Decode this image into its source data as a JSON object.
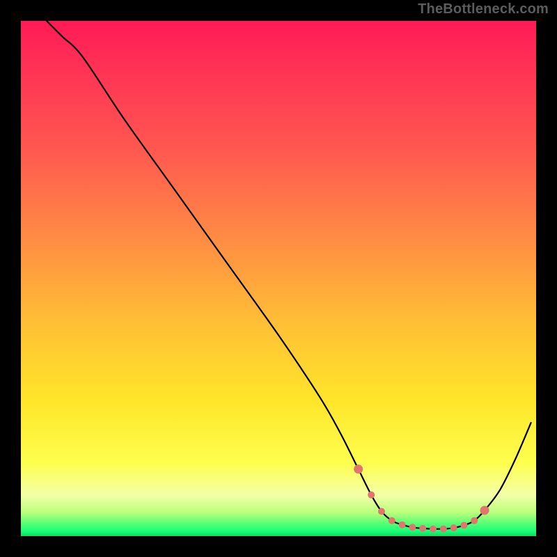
{
  "watermark": "TheBottleneck.com",
  "chart_data": {
    "type": "line",
    "title": "",
    "xlabel": "",
    "ylabel": "",
    "xlim": [
      0,
      100
    ],
    "ylim": [
      0,
      100
    ],
    "series": [
      {
        "name": "curve",
        "x": [
          5,
          8,
          12,
          20,
          30,
          40,
          50,
          58,
          62,
          65.5,
          68,
          70,
          72,
          74,
          76,
          78,
          80,
          82,
          84,
          86,
          88,
          90,
          93,
          96,
          99
        ],
        "values": [
          100,
          97,
          93,
          81,
          67,
          53,
          39,
          27,
          20,
          13,
          8,
          4.8,
          3.0,
          2.2,
          1.7,
          1.5,
          1.4,
          1.4,
          1.6,
          2.1,
          3.0,
          5.0,
          9.0,
          15,
          22
        ]
      }
    ],
    "markers": {
      "name": "optimum-band",
      "color_hex": "#e0766c",
      "x": [
        65.5,
        68,
        70,
        72,
        74,
        76,
        78,
        80,
        82,
        84,
        86,
        88,
        90
      ],
      "values": [
        13,
        8,
        4.8,
        3.0,
        2.2,
        1.7,
        1.5,
        1.4,
        1.4,
        1.6,
        2.1,
        3.0,
        5.0
      ]
    },
    "gradient_bands": [
      {
        "label": "red",
        "approx_y_range": [
          70,
          100
        ],
        "color_hex": "#ff1a56"
      },
      {
        "label": "orange",
        "approx_y_range": [
          40,
          70
        ],
        "color_hex": "#ff8b44"
      },
      {
        "label": "yellow",
        "approx_y_range": [
          10,
          40
        ],
        "color_hex": "#ffe62a"
      },
      {
        "label": "pale",
        "approx_y_range": [
          4,
          10
        ],
        "color_hex": "#f4ffa8"
      },
      {
        "label": "green",
        "approx_y_range": [
          0,
          4
        ],
        "color_hex": "#2bff70"
      }
    ]
  }
}
